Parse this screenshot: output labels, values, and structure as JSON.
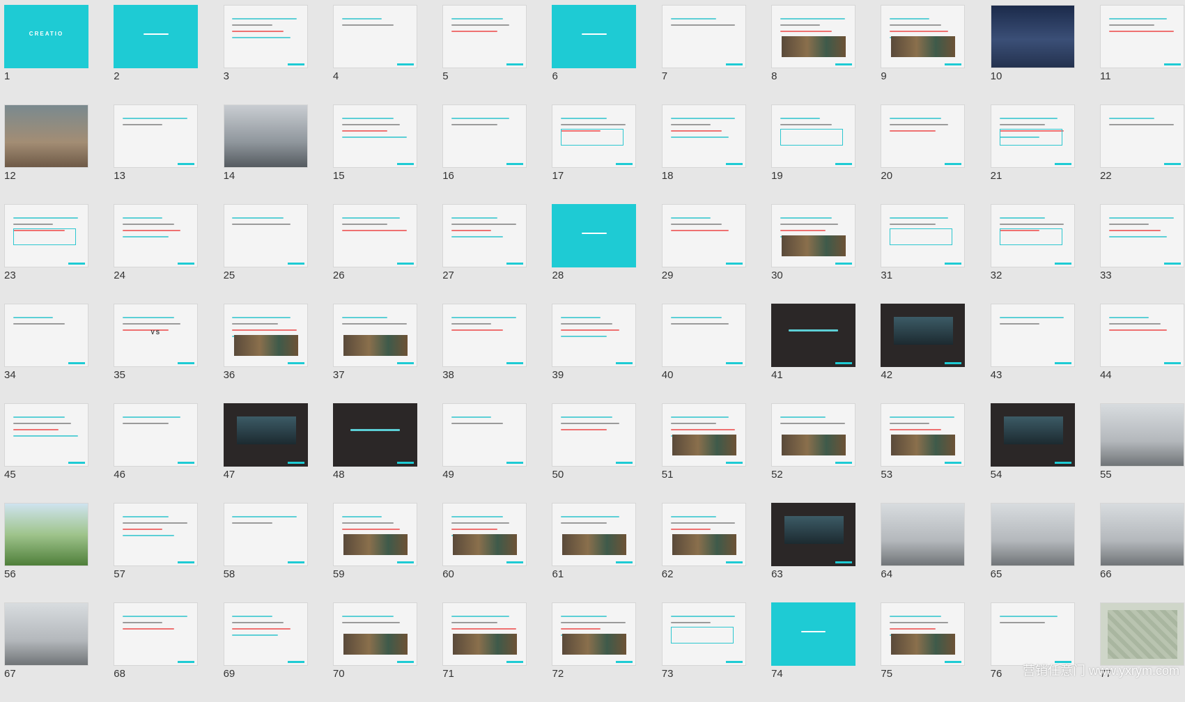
{
  "window": {
    "view": "slide-sorter"
  },
  "colors": {
    "accent": "#1ecbd4",
    "background": "#e6e6e6",
    "dark": "#2b2727"
  },
  "slides": [
    {
      "n": "1",
      "v": "cyan",
      "caption": "CREATIO"
    },
    {
      "n": "2",
      "v": "cyan",
      "caption": ""
    },
    {
      "n": "3",
      "v": "light",
      "caption": ""
    },
    {
      "n": "4",
      "v": "light",
      "caption": ""
    },
    {
      "n": "5",
      "v": "light",
      "caption": ""
    },
    {
      "n": "6",
      "v": "cyan",
      "caption": ""
    },
    {
      "n": "7",
      "v": "light",
      "caption": ""
    },
    {
      "n": "8",
      "v": "light-pic",
      "caption": ""
    },
    {
      "n": "9",
      "v": "light-pic",
      "caption": ""
    },
    {
      "n": "10",
      "v": "photo-night",
      "caption": ""
    },
    {
      "n": "11",
      "v": "light",
      "caption": ""
    },
    {
      "n": "12",
      "v": "photo-wood",
      "caption": ""
    },
    {
      "n": "13",
      "v": "light",
      "caption": ""
    },
    {
      "n": "14",
      "v": "photo-street",
      "caption": ""
    },
    {
      "n": "15",
      "v": "light",
      "caption": ""
    },
    {
      "n": "16",
      "v": "light",
      "caption": ""
    },
    {
      "n": "17",
      "v": "light-box",
      "caption": ""
    },
    {
      "n": "18",
      "v": "light",
      "caption": ""
    },
    {
      "n": "19",
      "v": "light-box",
      "caption": ""
    },
    {
      "n": "20",
      "v": "light",
      "caption": ""
    },
    {
      "n": "21",
      "v": "light-box",
      "caption": ""
    },
    {
      "n": "22",
      "v": "light",
      "caption": ""
    },
    {
      "n": "23",
      "v": "light-box",
      "caption": ""
    },
    {
      "n": "24",
      "v": "light",
      "caption": ""
    },
    {
      "n": "25",
      "v": "light",
      "caption": ""
    },
    {
      "n": "26",
      "v": "light",
      "caption": ""
    },
    {
      "n": "27",
      "v": "light",
      "caption": ""
    },
    {
      "n": "28",
      "v": "cyan",
      "caption": ""
    },
    {
      "n": "29",
      "v": "light",
      "caption": ""
    },
    {
      "n": "30",
      "v": "light-pic",
      "caption": ""
    },
    {
      "n": "31",
      "v": "light-box",
      "caption": ""
    },
    {
      "n": "32",
      "v": "light-box",
      "caption": ""
    },
    {
      "n": "33",
      "v": "light",
      "caption": ""
    },
    {
      "n": "34",
      "v": "light",
      "caption": ""
    },
    {
      "n": "35",
      "v": "light",
      "caption": "VS"
    },
    {
      "n": "36",
      "v": "light-pic",
      "caption": ""
    },
    {
      "n": "37",
      "v": "light-pic",
      "caption": ""
    },
    {
      "n": "38",
      "v": "light",
      "caption": ""
    },
    {
      "n": "39",
      "v": "light",
      "caption": ""
    },
    {
      "n": "40",
      "v": "light",
      "caption": ""
    },
    {
      "n": "41",
      "v": "dark",
      "caption": ""
    },
    {
      "n": "42",
      "v": "dark-pic",
      "caption": ""
    },
    {
      "n": "43",
      "v": "light",
      "caption": ""
    },
    {
      "n": "44",
      "v": "light",
      "caption": ""
    },
    {
      "n": "45",
      "v": "light",
      "caption": ""
    },
    {
      "n": "46",
      "v": "light",
      "caption": ""
    },
    {
      "n": "47",
      "v": "dark-pic",
      "caption": ""
    },
    {
      "n": "48",
      "v": "dark",
      "caption": ""
    },
    {
      "n": "49",
      "v": "light",
      "caption": ""
    },
    {
      "n": "50",
      "v": "light",
      "caption": ""
    },
    {
      "n": "51",
      "v": "light-pic",
      "caption": ""
    },
    {
      "n": "52",
      "v": "light-pic",
      "caption": ""
    },
    {
      "n": "53",
      "v": "light-pic",
      "caption": ""
    },
    {
      "n": "54",
      "v": "dark-pic",
      "caption": ""
    },
    {
      "n": "55",
      "v": "photo-grey",
      "caption": ""
    },
    {
      "n": "56",
      "v": "photo-green",
      "caption": ""
    },
    {
      "n": "57",
      "v": "light",
      "caption": ""
    },
    {
      "n": "58",
      "v": "light",
      "caption": ""
    },
    {
      "n": "59",
      "v": "light-pic",
      "caption": ""
    },
    {
      "n": "60",
      "v": "light-pic",
      "caption": ""
    },
    {
      "n": "61",
      "v": "light-pic",
      "caption": ""
    },
    {
      "n": "62",
      "v": "light-pic",
      "caption": ""
    },
    {
      "n": "63",
      "v": "dark-pic",
      "caption": ""
    },
    {
      "n": "64",
      "v": "photo-grey",
      "caption": ""
    },
    {
      "n": "65",
      "v": "photo-grey",
      "caption": ""
    },
    {
      "n": "66",
      "v": "photo-grey",
      "caption": ""
    },
    {
      "n": "67",
      "v": "photo-grey",
      "caption": ""
    },
    {
      "n": "68",
      "v": "light",
      "caption": ""
    },
    {
      "n": "69",
      "v": "light",
      "caption": ""
    },
    {
      "n": "70",
      "v": "light-pic",
      "caption": ""
    },
    {
      "n": "71",
      "v": "light-pic",
      "caption": ""
    },
    {
      "n": "72",
      "v": "light-pic",
      "caption": ""
    },
    {
      "n": "73",
      "v": "light-box",
      "caption": ""
    },
    {
      "n": "74",
      "v": "cyan",
      "caption": ""
    },
    {
      "n": "75",
      "v": "light-pic",
      "caption": ""
    },
    {
      "n": "76",
      "v": "light",
      "caption": ""
    },
    {
      "n": "77",
      "v": "photo-map",
      "caption": ""
    }
  ],
  "watermark": "营销任意门 www.yxrym.com"
}
